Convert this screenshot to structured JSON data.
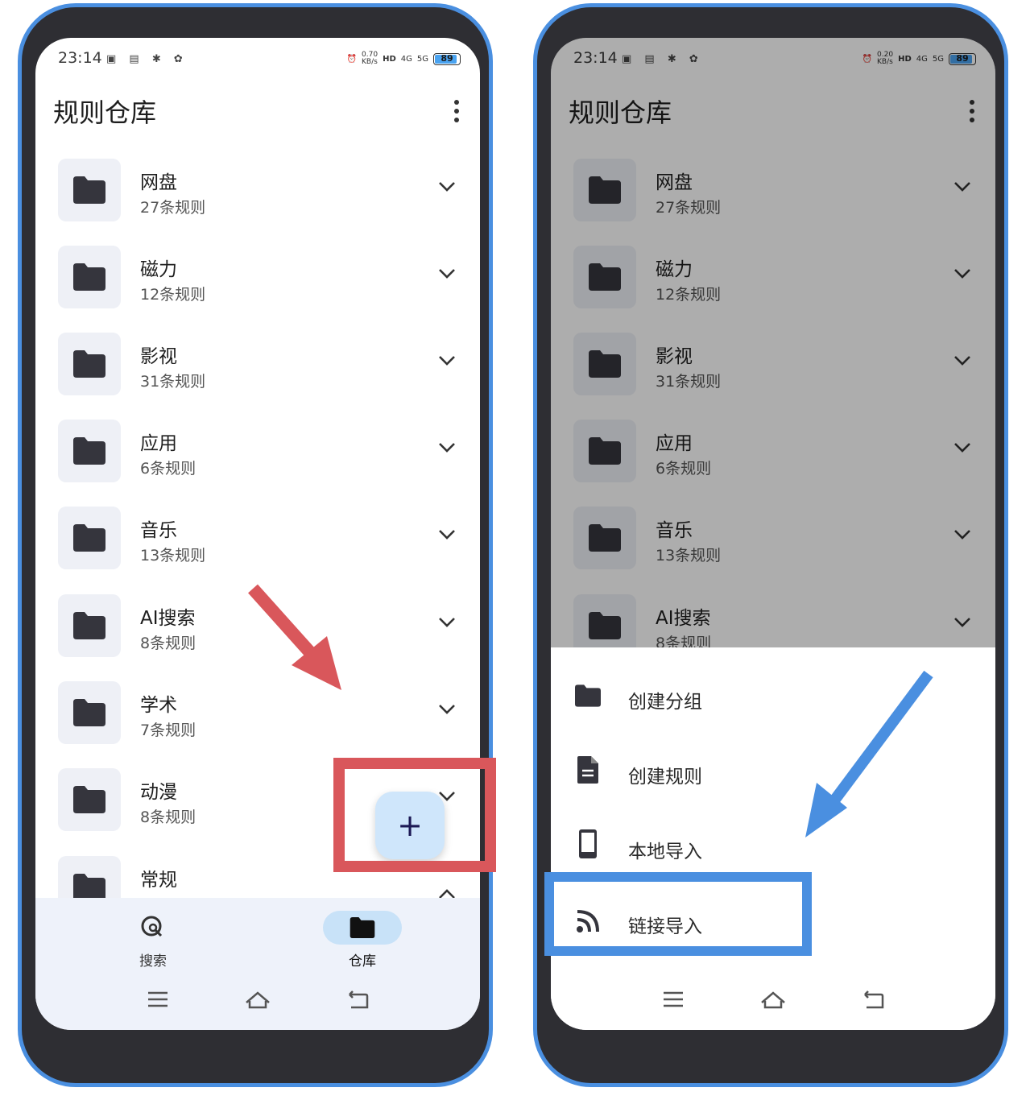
{
  "status": {
    "time": "23:14",
    "speed_left": "0.70",
    "speed_right": "0.20",
    "speed_unit": "KB/s",
    "hd": "HD",
    "net4g": "4G",
    "net5g": "5G",
    "battery": "89"
  },
  "header": {
    "title": "规则仓库"
  },
  "groups": [
    {
      "name": "网盘",
      "count": "27条规则"
    },
    {
      "name": "磁力",
      "count": "12条规则"
    },
    {
      "name": "影视",
      "count": "31条规则"
    },
    {
      "name": "应用",
      "count": "6条规则"
    },
    {
      "name": "音乐",
      "count": "13条规则"
    },
    {
      "name": "AI搜索",
      "count": "8条规则"
    },
    {
      "name": "学术",
      "count": "7条规则"
    },
    {
      "name": "动漫",
      "count": "8条规则"
    },
    {
      "name": "常规",
      "count": ""
    }
  ],
  "nav": {
    "search": "搜索",
    "repo": "仓库"
  },
  "fab": {
    "label": "+"
  },
  "sheet": {
    "create_group": "创建分组",
    "create_rule": "创建规则",
    "local_import": "本地导入",
    "link_import": "链接导入"
  },
  "colors": {
    "frame": "#4a8fe0",
    "red_annotation": "#d9575b",
    "blue_annotation": "#4a8fe0",
    "fab": "#cfe6fb",
    "nav_pill": "#c8e2f8"
  }
}
